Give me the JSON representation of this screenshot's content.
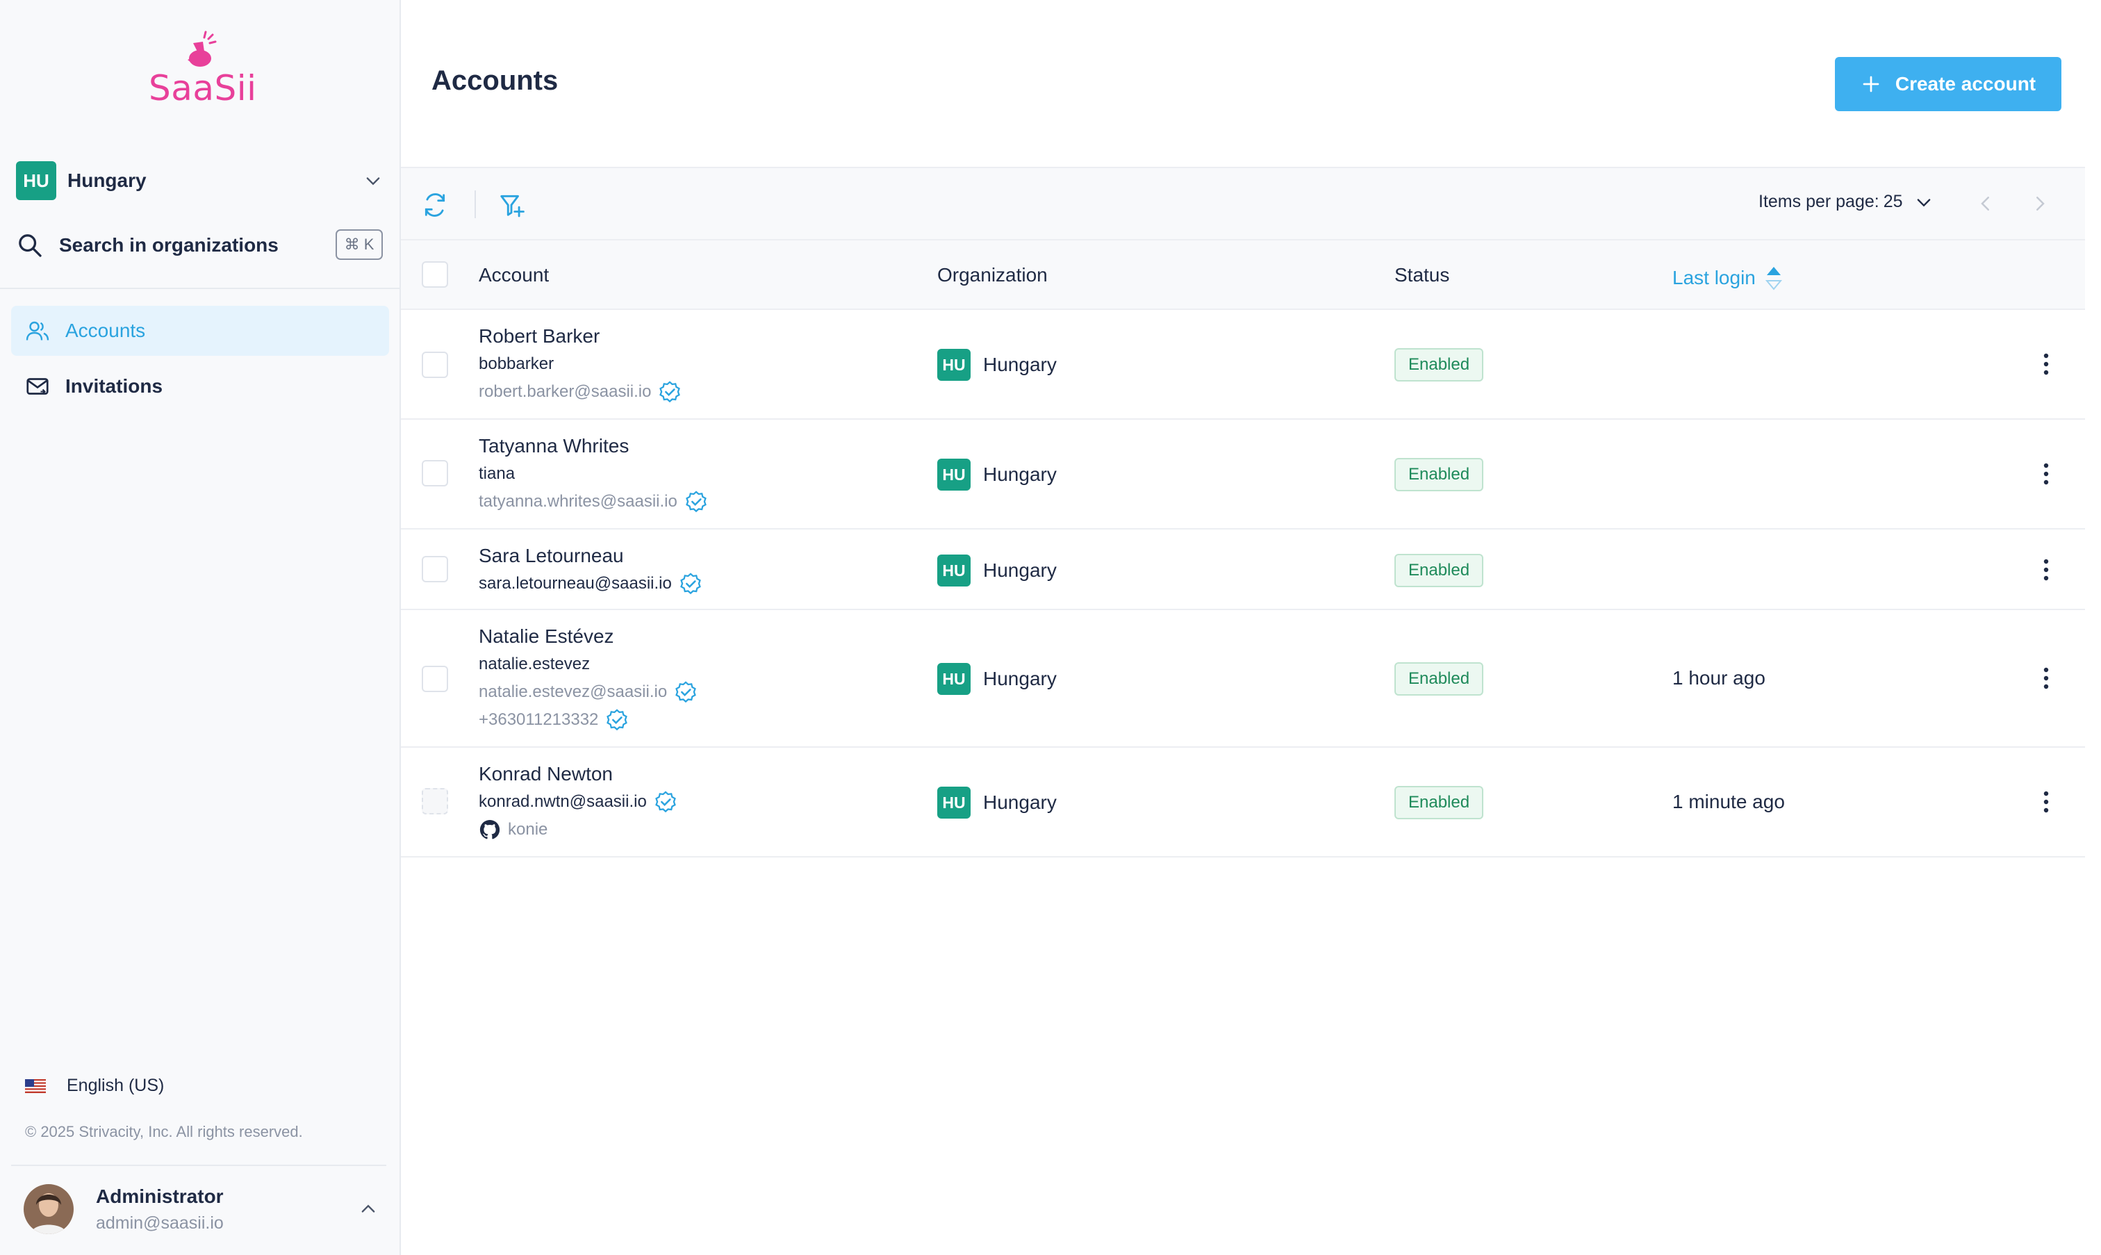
{
  "brand": {
    "name": "SaaSii",
    "color": "#e8409a"
  },
  "colors": {
    "accent": "#2aa3df",
    "button": "#3eb0f0",
    "badge_green": "#17a085",
    "status_text": "#1e8a5a"
  },
  "org_switcher": {
    "code": "HU",
    "name": "Hungary",
    "icon": "chevron-down-icon"
  },
  "search": {
    "label": "Search in organizations",
    "shortcut": "⌘ K",
    "icon": "search-icon"
  },
  "nav": {
    "items": [
      {
        "label": "Accounts",
        "icon": "users-icon",
        "active": true
      },
      {
        "label": "Invitations",
        "icon": "mail-icon",
        "active": false
      }
    ]
  },
  "language": {
    "label": "English (US)",
    "icon": "us-flag-icon"
  },
  "copyright": "© 2025 Strivacity, Inc. All rights reserved.",
  "user": {
    "name": "Administrator",
    "email": "admin@saasii.io"
  },
  "page": {
    "title": "Accounts"
  },
  "actions": {
    "create_label": "Create account"
  },
  "toolbar": {
    "items_per_page_label": "Items per page:",
    "items_per_page_value": "25"
  },
  "table": {
    "columns": {
      "account": "Account",
      "organization": "Organization",
      "status": "Status",
      "last_login": "Last login"
    },
    "rows": [
      {
        "name": "Robert Barker",
        "lines": [
          "bobbarker",
          "robert.barker@saasii.io"
        ],
        "org_code": "HU",
        "org_name": "Hungary",
        "status": "Enabled",
        "last_login": ""
      },
      {
        "name": "Tatyanna Whrites",
        "lines": [
          "tiana",
          "tatyanna.whrites@saasii.io"
        ],
        "org_code": "HU",
        "org_name": "Hungary",
        "status": "Enabled",
        "last_login": ""
      },
      {
        "name": "Sara Letourneau",
        "lines": [
          "sara.letourneau@saasii.io"
        ],
        "org_code": "HU",
        "org_name": "Hungary",
        "status": "Enabled",
        "last_login": ""
      },
      {
        "name": "Natalie Estévez",
        "lines": [
          "natalie.estevez",
          "natalie.estevez@saasii.io",
          "+363011213332"
        ],
        "org_code": "HU",
        "org_name": "Hungary",
        "status": "Enabled",
        "last_login": "1 hour ago"
      },
      {
        "name": "Konrad Newton",
        "lines": [
          "konrad.nwtn@saasii.io",
          "konie"
        ],
        "org_code": "HU",
        "org_name": "Hungary",
        "status": "Enabled",
        "last_login": "1 minute ago"
      }
    ]
  }
}
